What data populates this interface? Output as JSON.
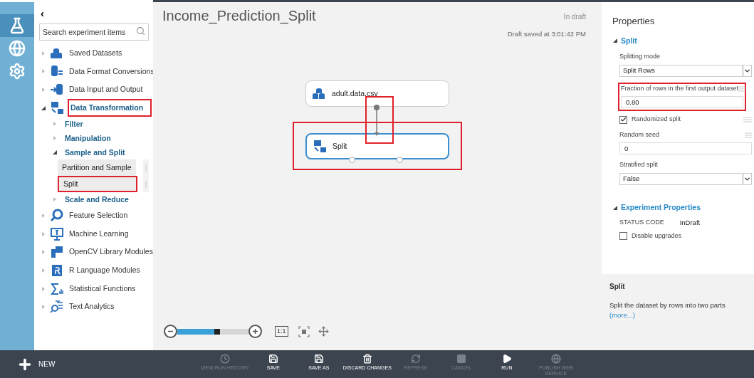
{
  "rail": [
    {
      "selected": true
    },
    {
      "selected": false
    },
    {
      "selected": false
    }
  ],
  "palette": {
    "collapse": "‹",
    "search": {
      "placeholder": "Search experiment items"
    },
    "items": [
      {
        "label": "Saved Datasets",
        "expanded": false,
        "marked": false
      },
      {
        "label": "Data Format Conversions",
        "expanded": false,
        "marked": false
      },
      {
        "label": "Data Input and Output",
        "expanded": false,
        "marked": false
      },
      {
        "label": "Data Transformation",
        "expanded": true,
        "marked": true,
        "children": [
          {
            "label": "Filter",
            "expanded": false
          },
          {
            "label": "Manipulation",
            "expanded": false
          },
          {
            "label": "Sample and Split",
            "expanded": true,
            "children": [
              {
                "label": "Partition and Sample",
                "marked": false
              },
              {
                "label": "Split",
                "marked": true
              }
            ]
          },
          {
            "label": "Scale and Reduce",
            "expanded": false
          }
        ]
      },
      {
        "label": "Feature Selection",
        "expanded": false,
        "marked": false
      },
      {
        "label": "Machine Learning",
        "expanded": false,
        "marked": false
      },
      {
        "label": "OpenCV Library Modules",
        "expanded": false,
        "marked": false
      },
      {
        "label": "R Language Modules",
        "expanded": false,
        "marked": false
      },
      {
        "label": "Statistical Functions",
        "expanded": false,
        "marked": false
      },
      {
        "label": "Text Analytics",
        "expanded": false,
        "marked": false
      }
    ]
  },
  "canvas": {
    "title": "Income_Prediction_Split",
    "status": "In draft",
    "saved": "Draft saved at 3:01:42 PM",
    "nodes": [
      {
        "label": "adult.data.csv",
        "kind": "dataset",
        "selected": false
      },
      {
        "label": "Split",
        "kind": "split",
        "selected": true
      }
    ],
    "zoom": {
      "level": 0.6,
      "actual_size": "1:1"
    }
  },
  "properties": {
    "title": "Properties",
    "section": {
      "title": "Split",
      "expanded": true,
      "fields": [
        {
          "kind": "dropdown",
          "label": "Splitting mode",
          "value": "Split Rows",
          "marked": false
        },
        {
          "kind": "text",
          "label": "Fraction of rows in the first output dataset",
          "value": "0.80",
          "marked": true
        },
        {
          "kind": "checkbox",
          "label": "Randomized split",
          "checked": true
        },
        {
          "kind": "text",
          "label": "Random seed",
          "value": "0",
          "marked": false
        },
        {
          "kind": "dropdown",
          "label": "Stratified split",
          "value": "False",
          "marked": false
        }
      ]
    },
    "experiment": {
      "title": "Experiment Properties",
      "expanded": true,
      "status_label": "STATUS CODE",
      "status_value": "InDraft",
      "option": {
        "label": "Disable upgrades",
        "checked": false
      }
    },
    "help": {
      "title": "Split",
      "text": "Split the dataset by rows into two parts",
      "link": "(more...)"
    }
  },
  "toolbar": {
    "new": "NEW",
    "commands": [
      {
        "label": "VIEW RUN HISTORY",
        "kind": "history",
        "disabled": true
      },
      {
        "label": "SAVE",
        "kind": "save",
        "disabled": false
      },
      {
        "label": "SAVE AS",
        "kind": "saveas",
        "disabled": false
      },
      {
        "label": "DISCARD CHANGES",
        "kind": "discard",
        "disabled": false
      },
      {
        "label": "REFRESH",
        "kind": "refresh",
        "disabled": true
      },
      {
        "label": "CANCEL",
        "kind": "cancel",
        "disabled": true
      },
      {
        "label": "RUN",
        "kind": "run",
        "disabled": false
      },
      {
        "label": "PUBLISH WEB SERVICE",
        "kind": "publish",
        "disabled": true
      }
    ]
  }
}
